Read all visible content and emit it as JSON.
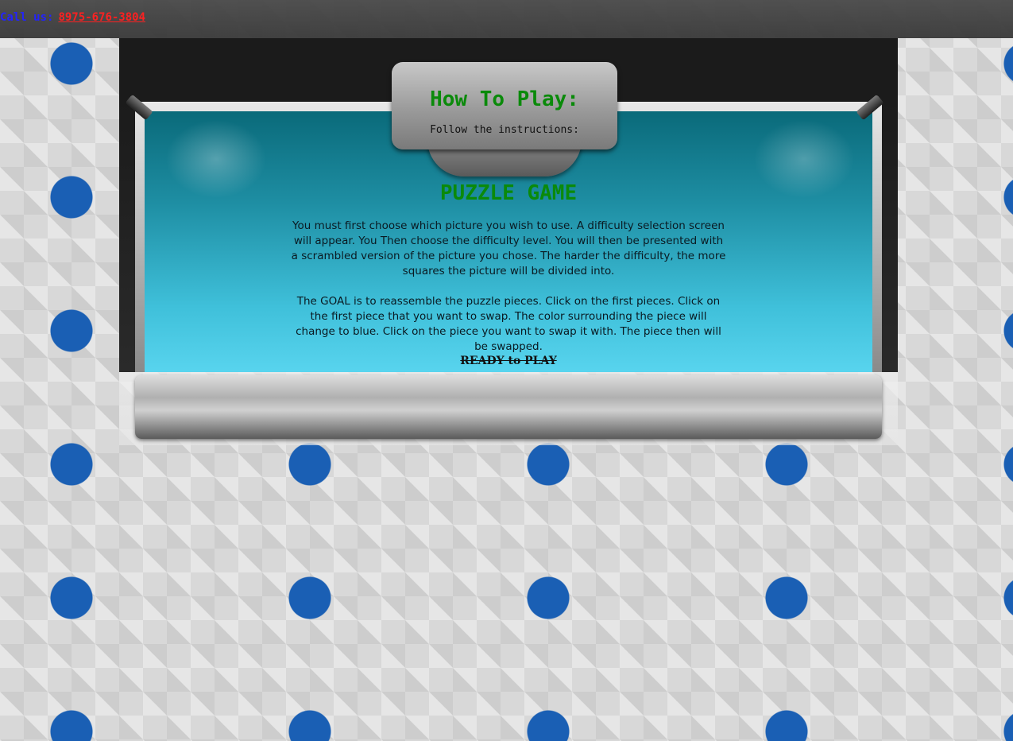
{
  "header": {
    "call_label": "Call us:",
    "phone": "8975-676-3804"
  },
  "sign": {
    "title": "How To Play:",
    "subtitle": "Follow the instructions:"
  },
  "content": {
    "game_title": "PUZZLE GAME",
    "paragraph_1": "You must first choose which picture you wish to use. A difficulty selection screen will appear. You Then choose the difficulty level. You will then be presented with a scrambled version of the picture you chose. The harder the difficulty, the more squares the picture will be divided into.",
    "paragraph_2": "The GOAL is to reassemble the puzzle pieces. Click on the first pieces. Click on the first piece that you want to swap. The color surrounding the piece will change to blue. Click on the piece you want to swap it with. The piece then will be swapped.",
    "ready_label": "READY to PLAY"
  },
  "colors": {
    "accent_green": "#0a8a0a",
    "call_label_blue": "#1c1cff",
    "phone_red": "#ff1a1a",
    "screen_cyan": "#3fc0da",
    "puzzle_hole_blue": "#1a5fb4"
  },
  "icons": {
    "left_bracket": "wall-mount-bracket-icon",
    "right_bracket": "wall-mount-bracket-icon"
  }
}
